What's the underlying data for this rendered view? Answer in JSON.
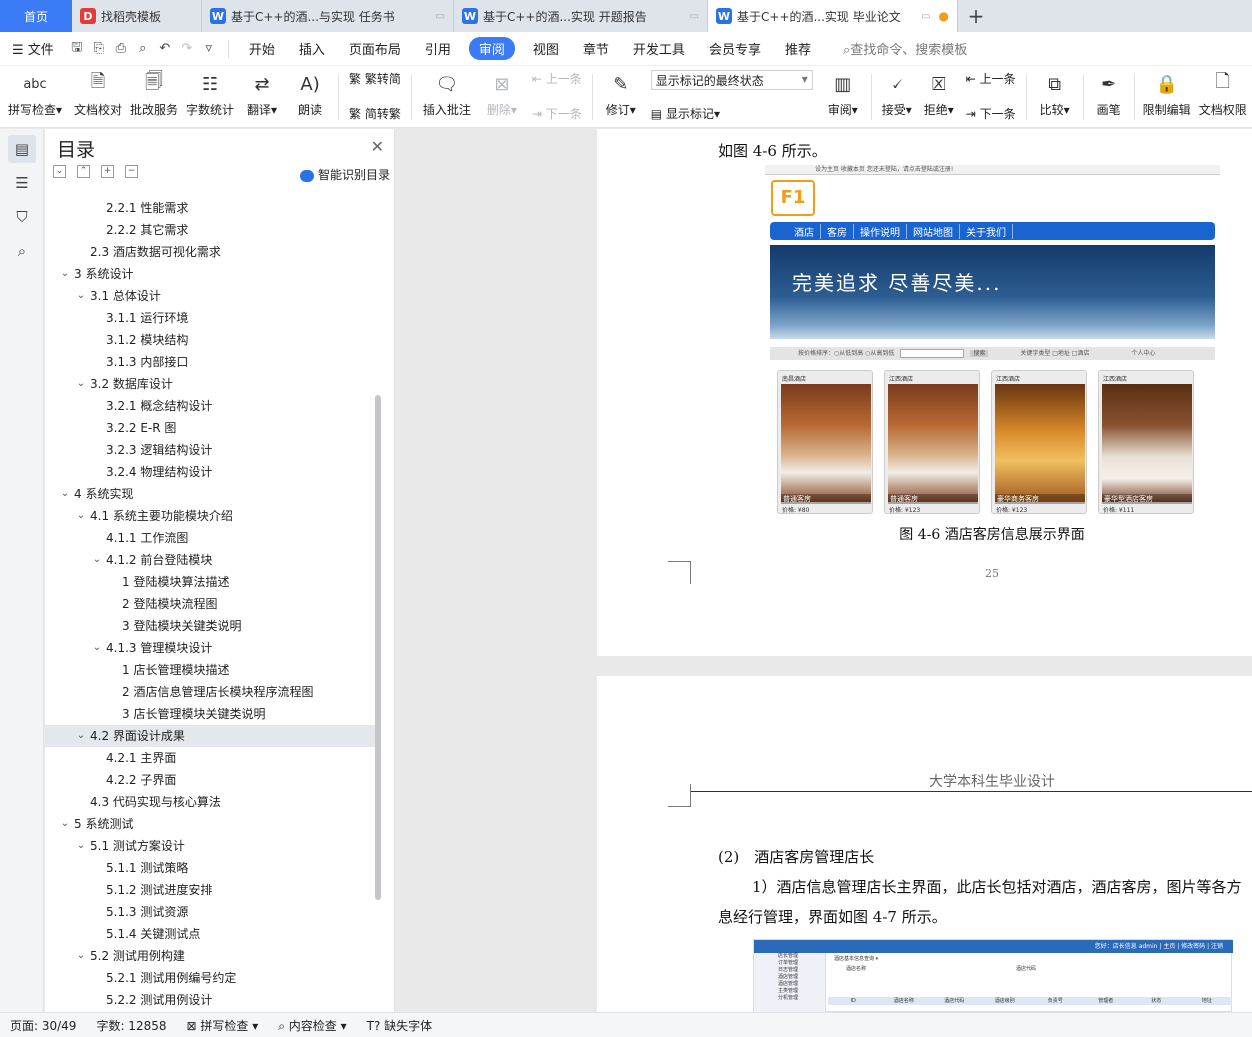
{
  "tabs": [
    {
      "label": "首页",
      "kind": "home"
    },
    {
      "label": "找稻壳模板",
      "kind": "docer"
    },
    {
      "label": "基于C++的酒...与实现 任务书",
      "kind": "doc"
    },
    {
      "label": "基于C++的酒...实现 开题报告",
      "kind": "doc"
    },
    {
      "label": "基于C++的酒...实现 毕业论文",
      "kind": "doc",
      "active": true
    }
  ],
  "menu": {
    "file": "文件",
    "items": [
      "开始",
      "插入",
      "页面布局",
      "引用",
      "审阅",
      "视图",
      "章节",
      "开发工具",
      "会员专享",
      "推荐"
    ],
    "active": "审阅",
    "search": "查找命令、搜索模板"
  },
  "ribbon": {
    "spell_icon": "abc",
    "spell": "拼写检查",
    "proof": "文档校对",
    "batch": "批改服务",
    "wordcount": "字数统计",
    "translate": "翻译",
    "read": "朗读",
    "trad": "繁转简",
    "simp": "简转繁",
    "insert_comment": "插入批注",
    "delete": "删除",
    "prev": "上一条",
    "next": "下一条",
    "track": "修订",
    "markup_select": "显示标记的最终状态",
    "show_markup": "显示标记",
    "review": "审阅",
    "accept": "接受",
    "reject": "拒绝",
    "prev2": "上一条",
    "next2": "下一条",
    "compare": "比较",
    "pen": "画笔",
    "restrict": "限制编辑",
    "perm": "文档权限"
  },
  "toc": {
    "title": "目录",
    "ai": "智能识别目录",
    "items": [
      {
        "text": "2.2.1 性能需求",
        "level": 3
      },
      {
        "text": "2.2.2 其它需求",
        "level": 3
      },
      {
        "text": "2.3 酒店数据可视化需求",
        "level": 2
      },
      {
        "text": "3 系统设计",
        "level": 1,
        "caret": true
      },
      {
        "text": "3.1 总体设计",
        "level": 2,
        "caret": true
      },
      {
        "text": "3.1.1 运行环境",
        "level": 3
      },
      {
        "text": "3.1.2 模块结构",
        "level": 3
      },
      {
        "text": "3.1.3 内部接口",
        "level": 3
      },
      {
        "text": "3.2 数据库设计",
        "level": 2,
        "caret": true
      },
      {
        "text": "3.2.1 概念结构设计",
        "level": 3
      },
      {
        "text": "3.2.2 E-R 图",
        "level": 3
      },
      {
        "text": "3.2.3 逻辑结构设计",
        "level": 3
      },
      {
        "text": "3.2.4 物理结构设计",
        "level": 3
      },
      {
        "text": "4 系统实现",
        "level": 1,
        "caret": true
      },
      {
        "text": "4.1 系统主要功能模块介绍",
        "level": 2,
        "caret": true
      },
      {
        "text": "4.1.1 工作流图",
        "level": 3
      },
      {
        "text": "4.1.2 前台登陆模块",
        "level": 3,
        "caret": true
      },
      {
        "text": "1 登陆模块算法描述",
        "level": 4
      },
      {
        "text": "2 登陆模块流程图",
        "level": 4
      },
      {
        "text": "3 登陆模块关键类说明",
        "level": 4
      },
      {
        "text": "4.1.3 管理模块设计",
        "level": 3,
        "caret": true
      },
      {
        "text": "1 店长管理模块描述",
        "level": 4
      },
      {
        "text": "2 酒店信息管理店长模块程序流程图",
        "level": 4
      },
      {
        "text": "3 店长管理模块关键类说明",
        "level": 4
      },
      {
        "text": "4.2 界面设计成果",
        "level": 2,
        "caret": true,
        "selected": true
      },
      {
        "text": "4.2.1 主界面",
        "level": 3
      },
      {
        "text": "4.2.2 子界面",
        "level": 3
      },
      {
        "text": "4.3 代码实现与核心算法",
        "level": 2
      },
      {
        "text": "5 系统测试",
        "level": 1,
        "caret": true
      },
      {
        "text": "5.1 测试方案设计",
        "level": 2,
        "caret": true
      },
      {
        "text": "5.1.1 测试策略",
        "level": 3
      },
      {
        "text": "5.1.2 测试进度安排",
        "level": 3
      },
      {
        "text": "5.1.3 测试资源",
        "level": 3
      },
      {
        "text": "5.1.4 关键测试点",
        "level": 3
      },
      {
        "text": "5.2 测试用例构建",
        "level": 2,
        "caret": true
      },
      {
        "text": "5.2.1 测试用例编号约定",
        "level": 3
      },
      {
        "text": "5.2.2 测试用例设计",
        "level": 3
      }
    ]
  },
  "page1": {
    "intro": "如图 4-6 所示。",
    "caption": "图 4-6 酒店客房信息展示界面",
    "page_number": "25",
    "web": {
      "topline": "设为主页 收藏本页 您还未登陆，请点击登陆或注册!",
      "logo": "F1",
      "nav": [
        "酒店",
        "客房",
        "操作说明",
        "网站地图",
        "关于我们"
      ],
      "banner": "完美追求 尽善尽美...",
      "search_left": "按价格排序：○从低到高 ○从高到低",
      "search_btn": "搜索",
      "search_right": "关键字类型 □地址 □酒店",
      "user": "个人中心",
      "cards": [
        {
          "city": "南昌酒店",
          "name": "普通客房",
          "price": "价格: ¥80"
        },
        {
          "city": "江西酒店",
          "name": "普通客房",
          "price": "价格: ¥123"
        },
        {
          "city": "江西酒店",
          "name": "豪华商务客房",
          "price": "价格: ¥123"
        },
        {
          "city": "江西酒店",
          "name": "豪华型酒店客房",
          "price": "价格: ¥111"
        }
      ]
    }
  },
  "page2": {
    "header": "大学本科生毕业设计",
    "heading": "(2)　酒店客房管理店长",
    "para1": "1）酒店信息管理店长主界面，此店长包括对酒店，酒店客房，图片等各方",
    "para2": "息经行管理，界面如图 4-7 所示。",
    "web2": {
      "header": "您好：店长信息 admin | 主页 | 修改密码 | 注销",
      "side": [
        "店长管理",
        "订单管理",
        "日志管理",
        "酒店管理",
        "酒店管理",
        "主类管理",
        "分机管理"
      ],
      "title": "酒店基本信息查询 ▾",
      "row1_a": "酒店名称",
      "row1_b": "酒店代码",
      "cols": [
        "ID",
        "酒店名称",
        "酒店代码",
        "酒店级别",
        "负责号",
        "管理者",
        "状态",
        "地址"
      ]
    }
  },
  "status": {
    "page": "页面: 30/49",
    "words": "字数: 12858",
    "spell": "拼写检查",
    "content": "内容检查",
    "font": "缺失字体"
  }
}
